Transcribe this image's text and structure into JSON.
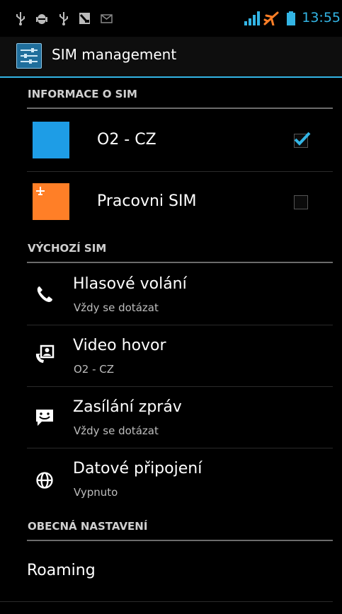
{
  "status_bar": {
    "time": "13:55",
    "left_icons": [
      "usb-icon",
      "android-debug-icon",
      "usb-icon",
      "screenshot-icon",
      "mail-icon"
    ],
    "right_icons": [
      "signal-icon",
      "airplane-mode-icon",
      "battery-icon"
    ],
    "accent": "#33b5e5"
  },
  "action_bar": {
    "title": "SIM management",
    "icon": "sim-settings-icon"
  },
  "sections": {
    "sim_info": "INFORMACE O SIM",
    "default_sim": "VÝCHOZÍ SIM",
    "general": "OBECNÁ NASTAVENÍ"
  },
  "sims": [
    {
      "label": "O2 - CZ",
      "color": "#1e9de6",
      "checked": true
    },
    {
      "label": "Pracovni SIM",
      "color": "#ff7f27",
      "checked": false,
      "badge": "airplane-icon"
    }
  ],
  "defaults": [
    {
      "title": "Hlasové volání",
      "subtitle": "Vždy se dotázat",
      "icon": "phone-icon"
    },
    {
      "title": "Video hovor",
      "subtitle": "O2 - CZ",
      "icon": "video-call-icon"
    },
    {
      "title": "Zasílání zpráv",
      "subtitle": "Vždy se dotázat",
      "icon": "message-icon"
    },
    {
      "title": "Datové připojení",
      "subtitle": "Vypnuto",
      "icon": "globe-icon"
    }
  ],
  "general": [
    {
      "title": "Roaming"
    }
  ]
}
